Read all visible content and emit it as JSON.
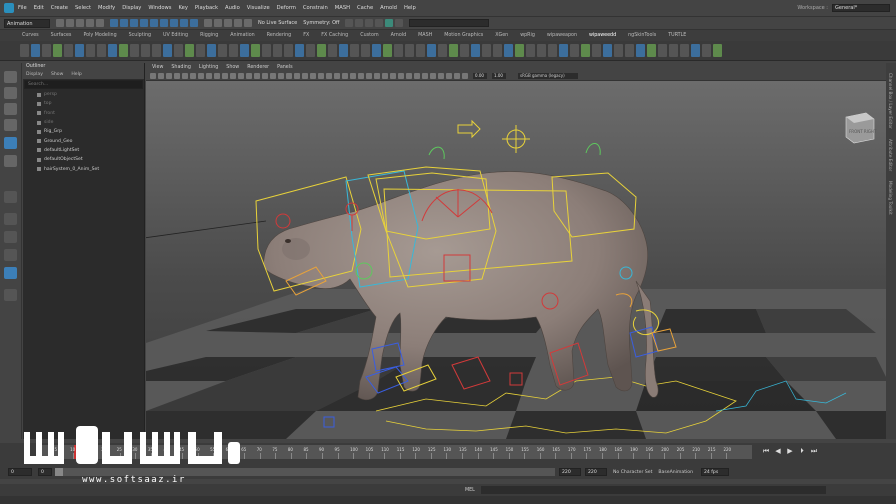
{
  "menubar": {
    "items": [
      "File",
      "Edit",
      "Create",
      "Select",
      "Modify",
      "Display",
      "Windows",
      "Key",
      "Playback",
      "Audio",
      "Visualize",
      "Deform",
      "Constrain",
      "MASH",
      "Cache",
      "Arnold",
      "Help"
    ],
    "workspace_label": "Workspace :",
    "workspace_value": "General*"
  },
  "statusline": {
    "mode": "Animation",
    "live_surface": "No Live Surface",
    "symmetry": "Symmetry: Off"
  },
  "shelf": {
    "tabs": [
      "Curves",
      "Surfaces",
      "Poly Modeling",
      "Sculpting",
      "UV Editing",
      "Rigging",
      "Animation",
      "Rendering",
      "FX",
      "FX Caching",
      "Custom",
      "Arnold",
      "MASH",
      "Motion Graphics",
      "XGen",
      "wpRig",
      "wipaweapon",
      "wipaweedd",
      "ngSkinTools",
      "TURTLE"
    ],
    "active_tab": "wipaweedd"
  },
  "outliner": {
    "title": "Outliner",
    "menu": [
      "Display",
      "Show",
      "Help"
    ],
    "search_placeholder": "Search...",
    "items": [
      {
        "label": "persp",
        "dim": true
      },
      {
        "label": "top",
        "dim": true
      },
      {
        "label": "front",
        "dim": true
      },
      {
        "label": "side",
        "dim": true
      },
      {
        "label": "Rig_Grp",
        "dim": false
      },
      {
        "label": "Ground_Geo",
        "dim": false
      },
      {
        "label": "defaultLightSet",
        "dim": false
      },
      {
        "label": "defaultObjectSet",
        "dim": false
      },
      {
        "label": "hairSystem_0_Anim_Set",
        "dim": false
      }
    ]
  },
  "viewport": {
    "menu": [
      "View",
      "Shading",
      "Lighting",
      "Show",
      "Renderer",
      "Panels"
    ],
    "field1": "0.00",
    "field2": "1.00",
    "colorspace": "sRGB gamma (legacy)",
    "viewcube_label": "FRONT RIGHT"
  },
  "right_strip": {
    "labels": [
      "Channel Box / Layer Editor",
      "Attribute Editor",
      "Modeling Toolkit"
    ]
  },
  "timeline": {
    "ticks": [
      "5",
      "10",
      "15",
      "20",
      "25",
      "30",
      "35",
      "40",
      "45",
      "50",
      "55",
      "60",
      "65",
      "70",
      "75",
      "80",
      "85",
      "90",
      "95",
      "100",
      "105",
      "110",
      "115",
      "120",
      "125",
      "130",
      "135",
      "140",
      "145",
      "150",
      "155",
      "160",
      "165",
      "170",
      "175",
      "180",
      "185",
      "190",
      "195",
      "200",
      "205",
      "210",
      "215",
      "220"
    ],
    "current": "1"
  },
  "range": {
    "start": "0",
    "current_start": "0",
    "end": "220",
    "end2": "220",
    "character_set": "No Character Set",
    "anim_layer": "BaseAnimation",
    "fps": "24 fps"
  },
  "cmdline": {
    "lang": "MEL"
  },
  "watermark": {
    "text": "www.softsaaz.ir"
  },
  "colors": {
    "accent": "#2a8fbd",
    "rig_yellow": "#e8d23a",
    "rig_red": "#d23a3a",
    "rig_blue": "#3a5ee0",
    "rig_cyan": "#38b8d8",
    "creature": "#8c7e78"
  }
}
